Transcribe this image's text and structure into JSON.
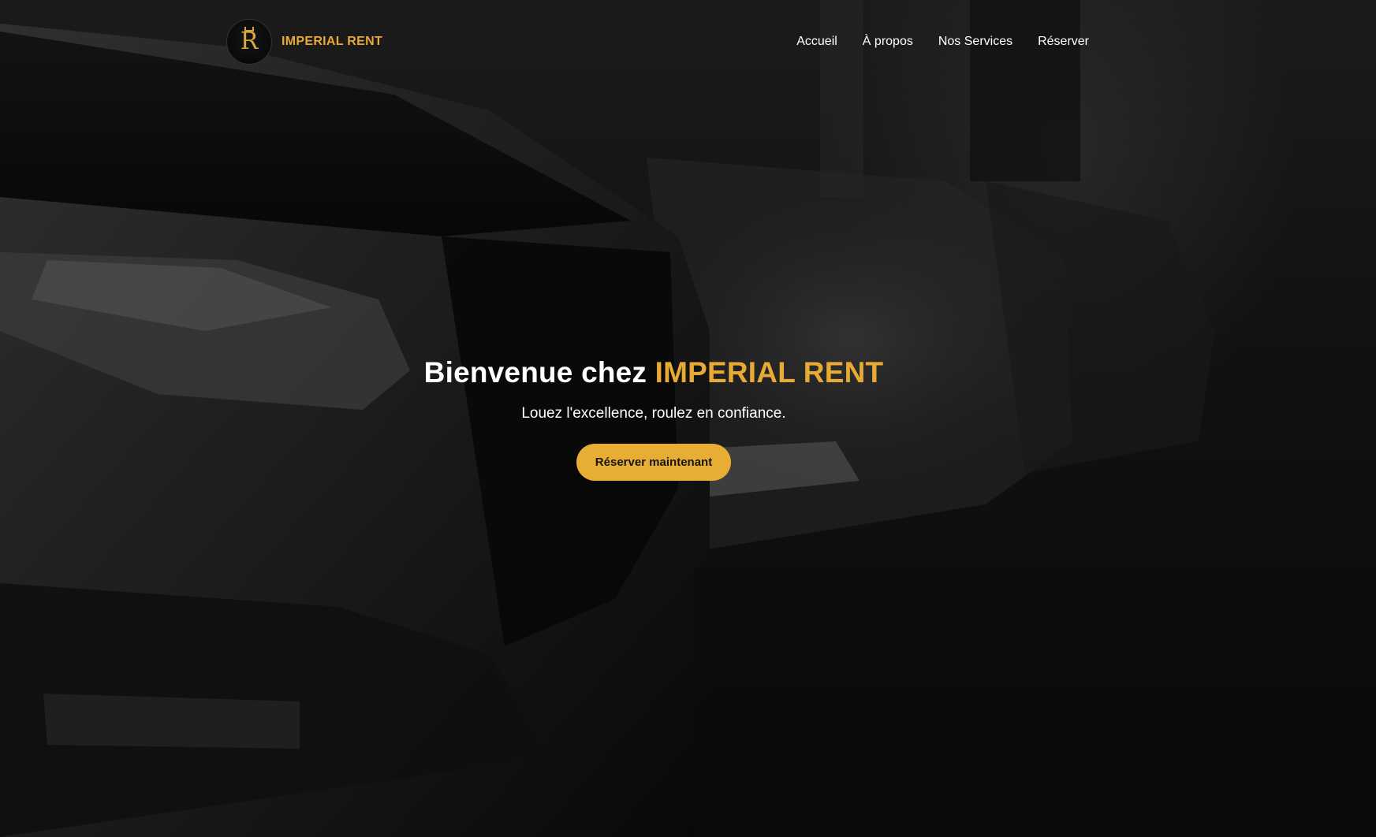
{
  "brand": {
    "logo_letter": "R",
    "name": "IMPERIAL RENT"
  },
  "nav": {
    "items": [
      {
        "label": "Accueil"
      },
      {
        "label": "À propos"
      },
      {
        "label": "Nos Services"
      },
      {
        "label": "Réserver"
      }
    ]
  },
  "hero": {
    "title_prefix": "Bienvenue chez ",
    "title_highlight": "IMPERIAL RENT",
    "subtitle": "Louez l'excellence, roulez en confiance.",
    "cta_label": "Réserver maintenant"
  },
  "colors": {
    "accent": "#e8a935",
    "button": "#e8ad35",
    "text": "#ffffff",
    "background": "#111111"
  },
  "background_image": "car-headlights-photo"
}
